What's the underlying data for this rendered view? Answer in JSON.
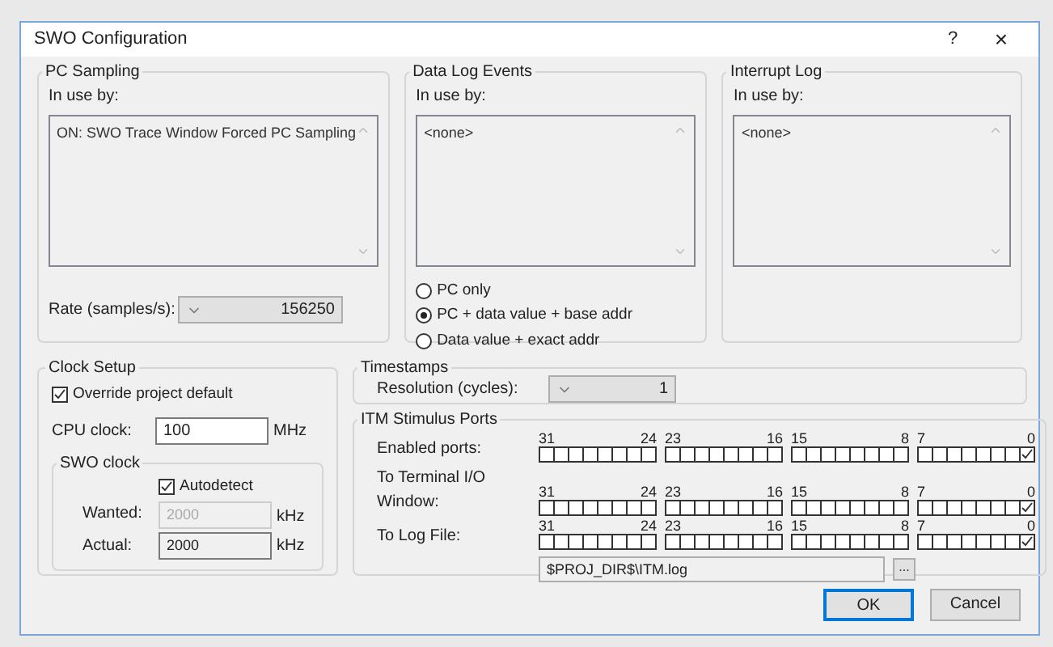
{
  "window": {
    "title": "SWO Configuration",
    "help": "?",
    "close": "×"
  },
  "pc_sampling": {
    "title": "PC Sampling",
    "in_use_label": "In use by:",
    "in_use_items": [
      "ON: SWO Trace Window Forced PC Sampling"
    ],
    "rate_label": "Rate (samples/s):",
    "rate_value": "156250"
  },
  "data_log_events": {
    "title": "Data Log Events",
    "in_use_label": "In use by:",
    "in_use_items": [
      "<none>"
    ],
    "options": [
      {
        "label": "PC only",
        "selected": false
      },
      {
        "label": "PC + data value + base addr",
        "selected": true
      },
      {
        "label": "Data value + exact addr",
        "selected": false
      }
    ]
  },
  "interrupt_log": {
    "title": "Interrupt Log",
    "in_use_label": "In use by:",
    "in_use_items": [
      "<none>"
    ]
  },
  "clock_setup": {
    "title": "Clock Setup",
    "override": {
      "label": "Override project default",
      "checked": true
    },
    "cpu_clock_label": "CPU clock:",
    "cpu_clock_value": "100",
    "cpu_clock_unit": "MHz",
    "swo_clock": {
      "title": "SWO clock",
      "autodetect": {
        "label": "Autodetect",
        "checked": true
      },
      "wanted_label": "Wanted:",
      "wanted_value": "2000",
      "wanted_disabled": true,
      "wanted_unit": "kHz",
      "actual_label": "Actual:",
      "actual_value": "2000",
      "actual_unit": "kHz"
    }
  },
  "timestamps": {
    "title": "Timestamps",
    "resolution_label": "Resolution (cycles):",
    "resolution_value": "1"
  },
  "itm_stimulus_ports": {
    "title": "ITM Stimulus Ports",
    "rows": [
      {
        "label": "Enabled ports:",
        "groups": [
          {
            "high": "31",
            "low": "24",
            "bits": [
              false,
              false,
              false,
              false,
              false,
              false,
              false,
              false
            ]
          },
          {
            "high": "23",
            "low": "16",
            "bits": [
              false,
              false,
              false,
              false,
              false,
              false,
              false,
              false
            ]
          },
          {
            "high": "15",
            "low": "8",
            "bits": [
              false,
              false,
              false,
              false,
              false,
              false,
              false,
              false
            ]
          },
          {
            "high": "7",
            "low": "0",
            "bits": [
              false,
              false,
              false,
              false,
              false,
              false,
              false,
              true
            ]
          }
        ]
      },
      {
        "label": "To Terminal I/O Window:",
        "groups": [
          {
            "high": "31",
            "low": "24",
            "bits": [
              false,
              false,
              false,
              false,
              false,
              false,
              false,
              false
            ]
          },
          {
            "high": "23",
            "low": "16",
            "bits": [
              false,
              false,
              false,
              false,
              false,
              false,
              false,
              false
            ]
          },
          {
            "high": "15",
            "low": "8",
            "bits": [
              false,
              false,
              false,
              false,
              false,
              false,
              false,
              false
            ]
          },
          {
            "high": "7",
            "low": "0",
            "bits": [
              false,
              false,
              false,
              false,
              false,
              false,
              false,
              true
            ]
          }
        ]
      },
      {
        "label": "To Log File:",
        "groups": [
          {
            "high": "31",
            "low": "24",
            "bits": [
              false,
              false,
              false,
              false,
              false,
              false,
              false,
              false
            ]
          },
          {
            "high": "23",
            "low": "16",
            "bits": [
              false,
              false,
              false,
              false,
              false,
              false,
              false,
              false
            ]
          },
          {
            "high": "15",
            "low": "8",
            "bits": [
              false,
              false,
              false,
              false,
              false,
              false,
              false,
              false
            ]
          },
          {
            "high": "7",
            "low": "0",
            "bits": [
              false,
              false,
              false,
              false,
              false,
              false,
              false,
              true
            ]
          }
        ]
      }
    ],
    "log_file_path": "$PROJ_DIR$\\ITM.log",
    "browse": "..."
  },
  "buttons": [
    {
      "label": "OK",
      "default": true
    },
    {
      "label": "Cancel",
      "default": false
    }
  ]
}
